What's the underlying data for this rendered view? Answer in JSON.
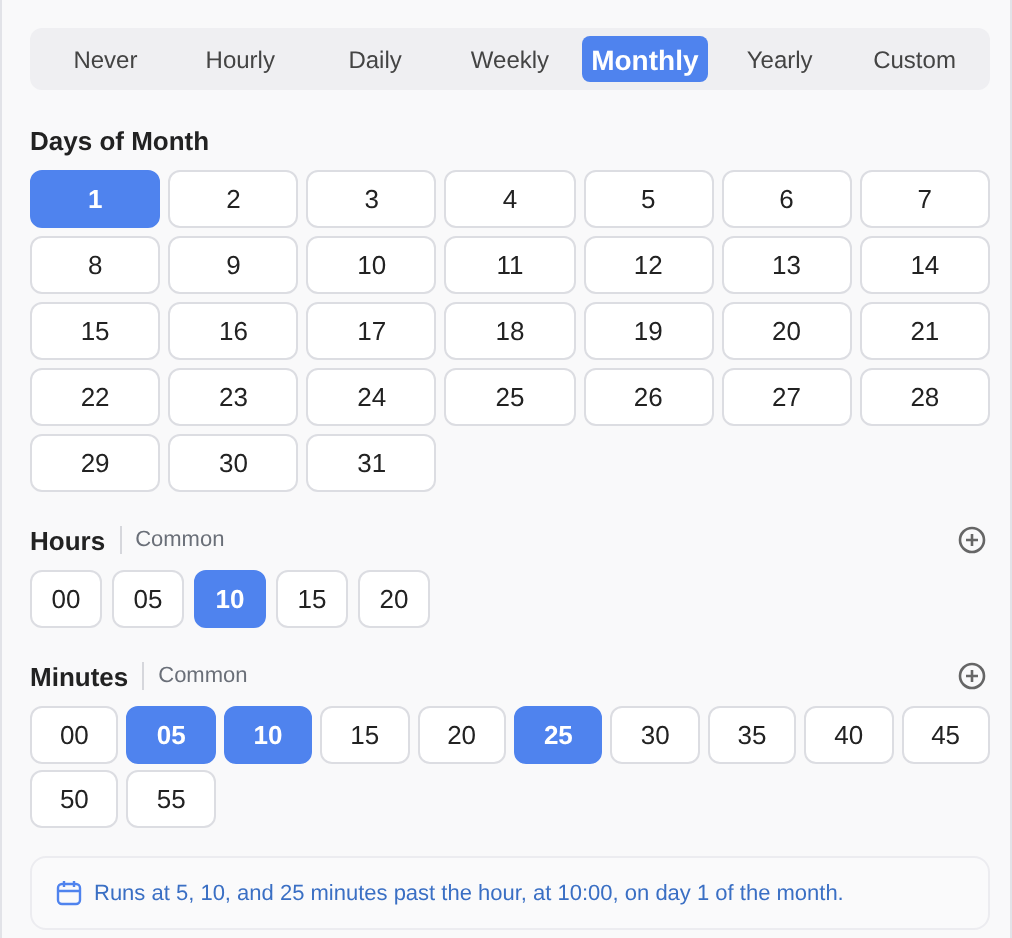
{
  "tabs": [
    {
      "label": "Never",
      "selected": false
    },
    {
      "label": "Hourly",
      "selected": false
    },
    {
      "label": "Daily",
      "selected": false
    },
    {
      "label": "Weekly",
      "selected": false
    },
    {
      "label": "Monthly",
      "selected": true
    },
    {
      "label": "Yearly",
      "selected": false
    },
    {
      "label": "Custom",
      "selected": false
    }
  ],
  "days": {
    "title": "Days of Month",
    "options": [
      {
        "label": "1",
        "selected": true
      },
      {
        "label": "2",
        "selected": false
      },
      {
        "label": "3",
        "selected": false
      },
      {
        "label": "4",
        "selected": false
      },
      {
        "label": "5",
        "selected": false
      },
      {
        "label": "6",
        "selected": false
      },
      {
        "label": "7",
        "selected": false
      },
      {
        "label": "8",
        "selected": false
      },
      {
        "label": "9",
        "selected": false
      },
      {
        "label": "10",
        "selected": false
      },
      {
        "label": "11",
        "selected": false
      },
      {
        "label": "12",
        "selected": false
      },
      {
        "label": "13",
        "selected": false
      },
      {
        "label": "14",
        "selected": false
      },
      {
        "label": "15",
        "selected": false
      },
      {
        "label": "16",
        "selected": false
      },
      {
        "label": "17",
        "selected": false
      },
      {
        "label": "18",
        "selected": false
      },
      {
        "label": "19",
        "selected": false
      },
      {
        "label": "20",
        "selected": false
      },
      {
        "label": "21",
        "selected": false
      },
      {
        "label": "22",
        "selected": false
      },
      {
        "label": "23",
        "selected": false
      },
      {
        "label": "24",
        "selected": false
      },
      {
        "label": "25",
        "selected": false
      },
      {
        "label": "26",
        "selected": false
      },
      {
        "label": "27",
        "selected": false
      },
      {
        "label": "28",
        "selected": false
      },
      {
        "label": "29",
        "selected": false
      },
      {
        "label": "30",
        "selected": false
      },
      {
        "label": "31",
        "selected": false
      }
    ]
  },
  "hours": {
    "title": "Hours",
    "subtitle": "Common",
    "options": [
      {
        "label": "00",
        "selected": false
      },
      {
        "label": "05",
        "selected": false
      },
      {
        "label": "10",
        "selected": true
      },
      {
        "label": "15",
        "selected": false
      },
      {
        "label": "20",
        "selected": false
      }
    ]
  },
  "minutes": {
    "title": "Minutes",
    "subtitle": "Common",
    "options": [
      {
        "label": "00",
        "selected": false
      },
      {
        "label": "05",
        "selected": true
      },
      {
        "label": "10",
        "selected": true
      },
      {
        "label": "15",
        "selected": false
      },
      {
        "label": "20",
        "selected": false
      },
      {
        "label": "25",
        "selected": true
      },
      {
        "label": "30",
        "selected": false
      },
      {
        "label": "35",
        "selected": false
      },
      {
        "label": "40",
        "selected": false
      },
      {
        "label": "45",
        "selected": false
      },
      {
        "label": "50",
        "selected": false
      },
      {
        "label": "55",
        "selected": false
      }
    ]
  },
  "summary": "Runs at 5, 10, and 25 minutes past the hour, at 10:00, on day 1 of the month."
}
